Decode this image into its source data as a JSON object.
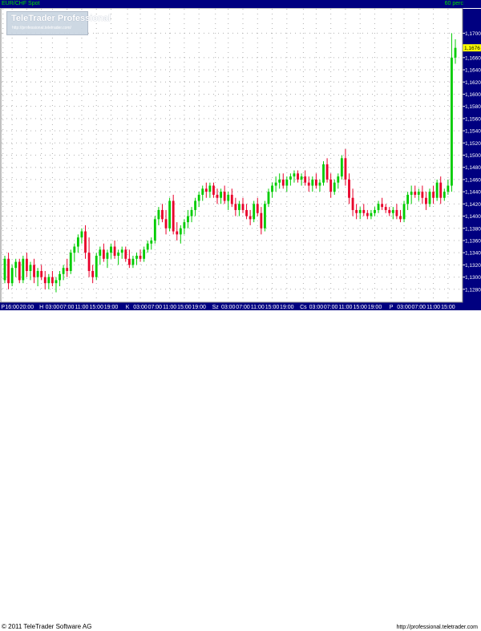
{
  "header": {
    "symbol": "EUR/CHF Spot",
    "period": "60 perc"
  },
  "watermark": {
    "title": "TeleTrader Professional",
    "url": "http://professional.teletrader.com/"
  },
  "footer": {
    "copyright": "© 2011 TeleTrader Software AG",
    "url": "http://professional.teletrader.com"
  },
  "colors": {
    "up": "#00cc00",
    "down": "#e8002a",
    "background": "#ffffff",
    "grid": "#b0b0b0",
    "axis_bar": "#000080",
    "axis_text": "#ffffff",
    "last_price_bg": "#ffff00"
  },
  "chart_data": {
    "type": "candlestick",
    "title": "EUR/CHF Spot",
    "interval": "60 perc",
    "grid": true,
    "ylim": [
      1.126,
      1.174
    ],
    "y_ticks": [
      "1,1700",
      "1,1660",
      "1,1640",
      "1,1620",
      "1,1600",
      "1,1580",
      "1,1560",
      "1,1540",
      "1,1520",
      "1,1500",
      "1,1480",
      "1,1460",
      "1,1440",
      "1,1420",
      "1,1400",
      "1,1380",
      "1,1360",
      "1,1340",
      "1,1320",
      "1,1300",
      "1,1280"
    ],
    "y_tick_values": [
      1.17,
      1.166,
      1.164,
      1.162,
      1.16,
      1.158,
      1.156,
      1.154,
      1.152,
      1.15,
      1.148,
      1.146,
      1.144,
      1.142,
      1.14,
      1.138,
      1.136,
      1.134,
      1.132,
      1.13,
      1.128
    ],
    "last_price": "1,1676",
    "last_price_value": 1.1676,
    "x_ticks": [
      {
        "label": "P",
        "i": -0.5
      },
      {
        "label": "16:00",
        "i": 2
      },
      {
        "label": "20:00",
        "i": 6
      },
      {
        "label": "H",
        "i": 10
      },
      {
        "label": "03:00",
        "i": 13
      },
      {
        "label": "07:00",
        "i": 17
      },
      {
        "label": "11:00",
        "i": 21
      },
      {
        "label": "15:00",
        "i": 25
      },
      {
        "label": "19:00",
        "i": 29
      },
      {
        "label": "K",
        "i": 33.5
      },
      {
        "label": "03:00",
        "i": 37
      },
      {
        "label": "07:00",
        "i": 41
      },
      {
        "label": "11:00",
        "i": 45
      },
      {
        "label": "15:00",
        "i": 49
      },
      {
        "label": "19:00",
        "i": 53
      },
      {
        "label": "Sz",
        "i": 57.5
      },
      {
        "label": "03:00",
        "i": 61
      },
      {
        "label": "07:00",
        "i": 65
      },
      {
        "label": "11:00",
        "i": 69
      },
      {
        "label": "15:00",
        "i": 73
      },
      {
        "label": "19:00",
        "i": 77
      },
      {
        "label": "Cs",
        "i": 81.5
      },
      {
        "label": "03:00",
        "i": 85
      },
      {
        "label": "07:00",
        "i": 89
      },
      {
        "label": "11:00",
        "i": 93
      },
      {
        "label": "15:00",
        "i": 97
      },
      {
        "label": "19:00",
        "i": 101
      },
      {
        "label": "P",
        "i": 105.5
      },
      {
        "label": "03:00",
        "i": 109
      },
      {
        "label": "07:00",
        "i": 113
      },
      {
        "label": "11:00",
        "i": 117
      },
      {
        "label": "15:00",
        "i": 121
      }
    ],
    "candles": [
      [
        1.1295,
        1.1335,
        1.129,
        1.133
      ],
      [
        1.133,
        1.134,
        1.128,
        1.129
      ],
      [
        1.129,
        1.132,
        1.1285,
        1.1315
      ],
      [
        1.1315,
        1.133,
        1.13,
        1.1325
      ],
      [
        1.1325,
        1.133,
        1.129,
        1.1295
      ],
      [
        1.1295,
        1.1335,
        1.129,
        1.133
      ],
      [
        1.133,
        1.134,
        1.13,
        1.131
      ],
      [
        1.131,
        1.1325,
        1.1295,
        1.132
      ],
      [
        1.132,
        1.133,
        1.129,
        1.13
      ],
      [
        1.13,
        1.1315,
        1.1285,
        1.131
      ],
      [
        1.131,
        1.132,
        1.1295,
        1.13
      ],
      [
        1.13,
        1.131,
        1.128,
        1.129
      ],
      [
        1.129,
        1.1305,
        1.128,
        1.13
      ],
      [
        1.13,
        1.131,
        1.1285,
        1.129
      ],
      [
        1.129,
        1.13,
        1.1275,
        1.1295
      ],
      [
        1.1295,
        1.131,
        1.1285,
        1.1305
      ],
      [
        1.1305,
        1.132,
        1.1295,
        1.1315
      ],
      [
        1.1315,
        1.133,
        1.13,
        1.131
      ],
      [
        1.131,
        1.1345,
        1.1305,
        1.134
      ],
      [
        1.134,
        1.1355,
        1.1325,
        1.135
      ],
      [
        1.135,
        1.137,
        1.134,
        1.1365
      ],
      [
        1.1365,
        1.138,
        1.1355,
        1.1375
      ],
      [
        1.1375,
        1.1385,
        1.133,
        1.134
      ],
      [
        1.134,
        1.1365,
        1.13,
        1.131
      ],
      [
        1.131,
        1.132,
        1.129,
        1.13
      ],
      [
        1.13,
        1.134,
        1.1295,
        1.1335
      ],
      [
        1.1335,
        1.135,
        1.132,
        1.1345
      ],
      [
        1.1345,
        1.1355,
        1.1325,
        1.133
      ],
      [
        1.133,
        1.1345,
        1.1315,
        1.134
      ],
      [
        1.134,
        1.1355,
        1.133,
        1.135
      ],
      [
        1.135,
        1.136,
        1.133,
        1.1335
      ],
      [
        1.1335,
        1.1345,
        1.132,
        1.134
      ],
      [
        1.134,
        1.135,
        1.133,
        1.1345
      ],
      [
        1.1345,
        1.135,
        1.1325,
        1.133
      ],
      [
        1.133,
        1.1345,
        1.1315,
        1.132
      ],
      [
        1.132,
        1.1335,
        1.1315,
        1.133
      ],
      [
        1.133,
        1.134,
        1.132,
        1.1335
      ],
      [
        1.1335,
        1.1345,
        1.1325,
        1.133
      ],
      [
        1.133,
        1.135,
        1.1325,
        1.1345
      ],
      [
        1.1345,
        1.136,
        1.134,
        1.1355
      ],
      [
        1.1355,
        1.1365,
        1.1345,
        1.136
      ],
      [
        1.136,
        1.14,
        1.1355,
        1.1395
      ],
      [
        1.1395,
        1.1415,
        1.1385,
        1.141
      ],
      [
        1.141,
        1.142,
        1.139,
        1.1395
      ],
      [
        1.1395,
        1.141,
        1.137,
        1.138
      ],
      [
        1.138,
        1.143,
        1.1375,
        1.1425
      ],
      [
        1.1425,
        1.1435,
        1.137,
        1.1375
      ],
      [
        1.1375,
        1.139,
        1.136,
        1.137
      ],
      [
        1.137,
        1.1385,
        1.1355,
        1.138
      ],
      [
        1.138,
        1.1395,
        1.137,
        1.139
      ],
      [
        1.139,
        1.141,
        1.138,
        1.14
      ],
      [
        1.14,
        1.1415,
        1.139,
        1.141
      ],
      [
        1.141,
        1.143,
        1.14,
        1.1425
      ],
      [
        1.1425,
        1.144,
        1.1415,
        1.1435
      ],
      [
        1.1435,
        1.145,
        1.1425,
        1.1445
      ],
      [
        1.1445,
        1.1455,
        1.143,
        1.144
      ],
      [
        1.144,
        1.1455,
        1.143,
        1.145
      ],
      [
        1.145,
        1.1455,
        1.143,
        1.1435
      ],
      [
        1.1435,
        1.1445,
        1.142,
        1.143
      ],
      [
        1.143,
        1.1445,
        1.142,
        1.144
      ],
      [
        1.144,
        1.145,
        1.142,
        1.1425
      ],
      [
        1.1425,
        1.144,
        1.141,
        1.1435
      ],
      [
        1.1435,
        1.1445,
        1.1415,
        1.142
      ],
      [
        1.142,
        1.143,
        1.14,
        1.141
      ],
      [
        1.141,
        1.1425,
        1.14,
        1.142
      ],
      [
        1.142,
        1.143,
        1.1405,
        1.141
      ],
      [
        1.141,
        1.142,
        1.1395,
        1.14
      ],
      [
        1.14,
        1.141,
        1.1385,
        1.1395
      ],
      [
        1.1395,
        1.1425,
        1.139,
        1.142
      ],
      [
        1.142,
        1.143,
        1.14,
        1.1405
      ],
      [
        1.1405,
        1.1415,
        1.137,
        1.138
      ],
      [
        1.138,
        1.1425,
        1.1375,
        1.142
      ],
      [
        1.142,
        1.1445,
        1.1415,
        1.144
      ],
      [
        1.144,
        1.1455,
        1.143,
        1.145
      ],
      [
        1.145,
        1.1465,
        1.144,
        1.1455
      ],
      [
        1.1455,
        1.147,
        1.1445,
        1.146
      ],
      [
        1.146,
        1.147,
        1.1445,
        1.145
      ],
      [
        1.145,
        1.1465,
        1.144,
        1.146
      ],
      [
        1.146,
        1.147,
        1.145,
        1.1465
      ],
      [
        1.1465,
        1.1475,
        1.1455,
        1.147
      ],
      [
        1.147,
        1.1475,
        1.1455,
        1.146
      ],
      [
        1.146,
        1.147,
        1.145,
        1.1465
      ],
      [
        1.1465,
        1.1475,
        1.145,
        1.1455
      ],
      [
        1.1455,
        1.1465,
        1.144,
        1.145
      ],
      [
        1.145,
        1.1465,
        1.144,
        1.146
      ],
      [
        1.146,
        1.147,
        1.1445,
        1.145
      ],
      [
        1.145,
        1.146,
        1.144,
        1.1455
      ],
      [
        1.1455,
        1.149,
        1.145,
        1.1485
      ],
      [
        1.1485,
        1.1495,
        1.1455,
        1.146
      ],
      [
        1.146,
        1.147,
        1.143,
        1.144
      ],
      [
        1.144,
        1.146,
        1.1435,
        1.1455
      ],
      [
        1.1455,
        1.147,
        1.1445,
        1.1465
      ],
      [
        1.1465,
        1.15,
        1.146,
        1.1495
      ],
      [
        1.1495,
        1.151,
        1.145,
        1.146
      ],
      [
        1.146,
        1.147,
        1.142,
        1.143
      ],
      [
        1.143,
        1.1445,
        1.14,
        1.141
      ],
      [
        1.141,
        1.142,
        1.1395,
        1.1405
      ],
      [
        1.1405,
        1.1415,
        1.1395,
        1.141
      ],
      [
        1.141,
        1.142,
        1.14,
        1.1405
      ],
      [
        1.1405,
        1.141,
        1.1395,
        1.14
      ],
      [
        1.14,
        1.141,
        1.1395,
        1.1405
      ],
      [
        1.1405,
        1.1415,
        1.14,
        1.141
      ],
      [
        1.141,
        1.1425,
        1.1405,
        1.142
      ],
      [
        1.142,
        1.143,
        1.141,
        1.1415
      ],
      [
        1.1415,
        1.142,
        1.1405,
        1.141
      ],
      [
        1.141,
        1.1415,
        1.14,
        1.1405
      ],
      [
        1.1405,
        1.1415,
        1.1395,
        1.141
      ],
      [
        1.141,
        1.142,
        1.1395,
        1.14
      ],
      [
        1.14,
        1.141,
        1.139,
        1.1395
      ],
      [
        1.1395,
        1.1425,
        1.139,
        1.142
      ],
      [
        1.142,
        1.144,
        1.141,
        1.1435
      ],
      [
        1.1435,
        1.145,
        1.142,
        1.144
      ],
      [
        1.144,
        1.145,
        1.143,
        1.1435
      ],
      [
        1.1435,
        1.1445,
        1.1425,
        1.144
      ],
      [
        1.144,
        1.145,
        1.142,
        1.143
      ],
      [
        1.143,
        1.144,
        1.141,
        1.142
      ],
      [
        1.142,
        1.1445,
        1.1415,
        1.144
      ],
      [
        1.144,
        1.145,
        1.142,
        1.143
      ],
      [
        1.143,
        1.146,
        1.1425,
        1.1455
      ],
      [
        1.1455,
        1.1465,
        1.142,
        1.143
      ],
      [
        1.143,
        1.1445,
        1.1425,
        1.144
      ],
      [
        1.144,
        1.146,
        1.1435,
        1.145
      ],
      [
        1.145,
        1.17,
        1.144,
        1.166
      ],
      [
        1.166,
        1.169,
        1.165,
        1.1676
      ]
    ]
  }
}
